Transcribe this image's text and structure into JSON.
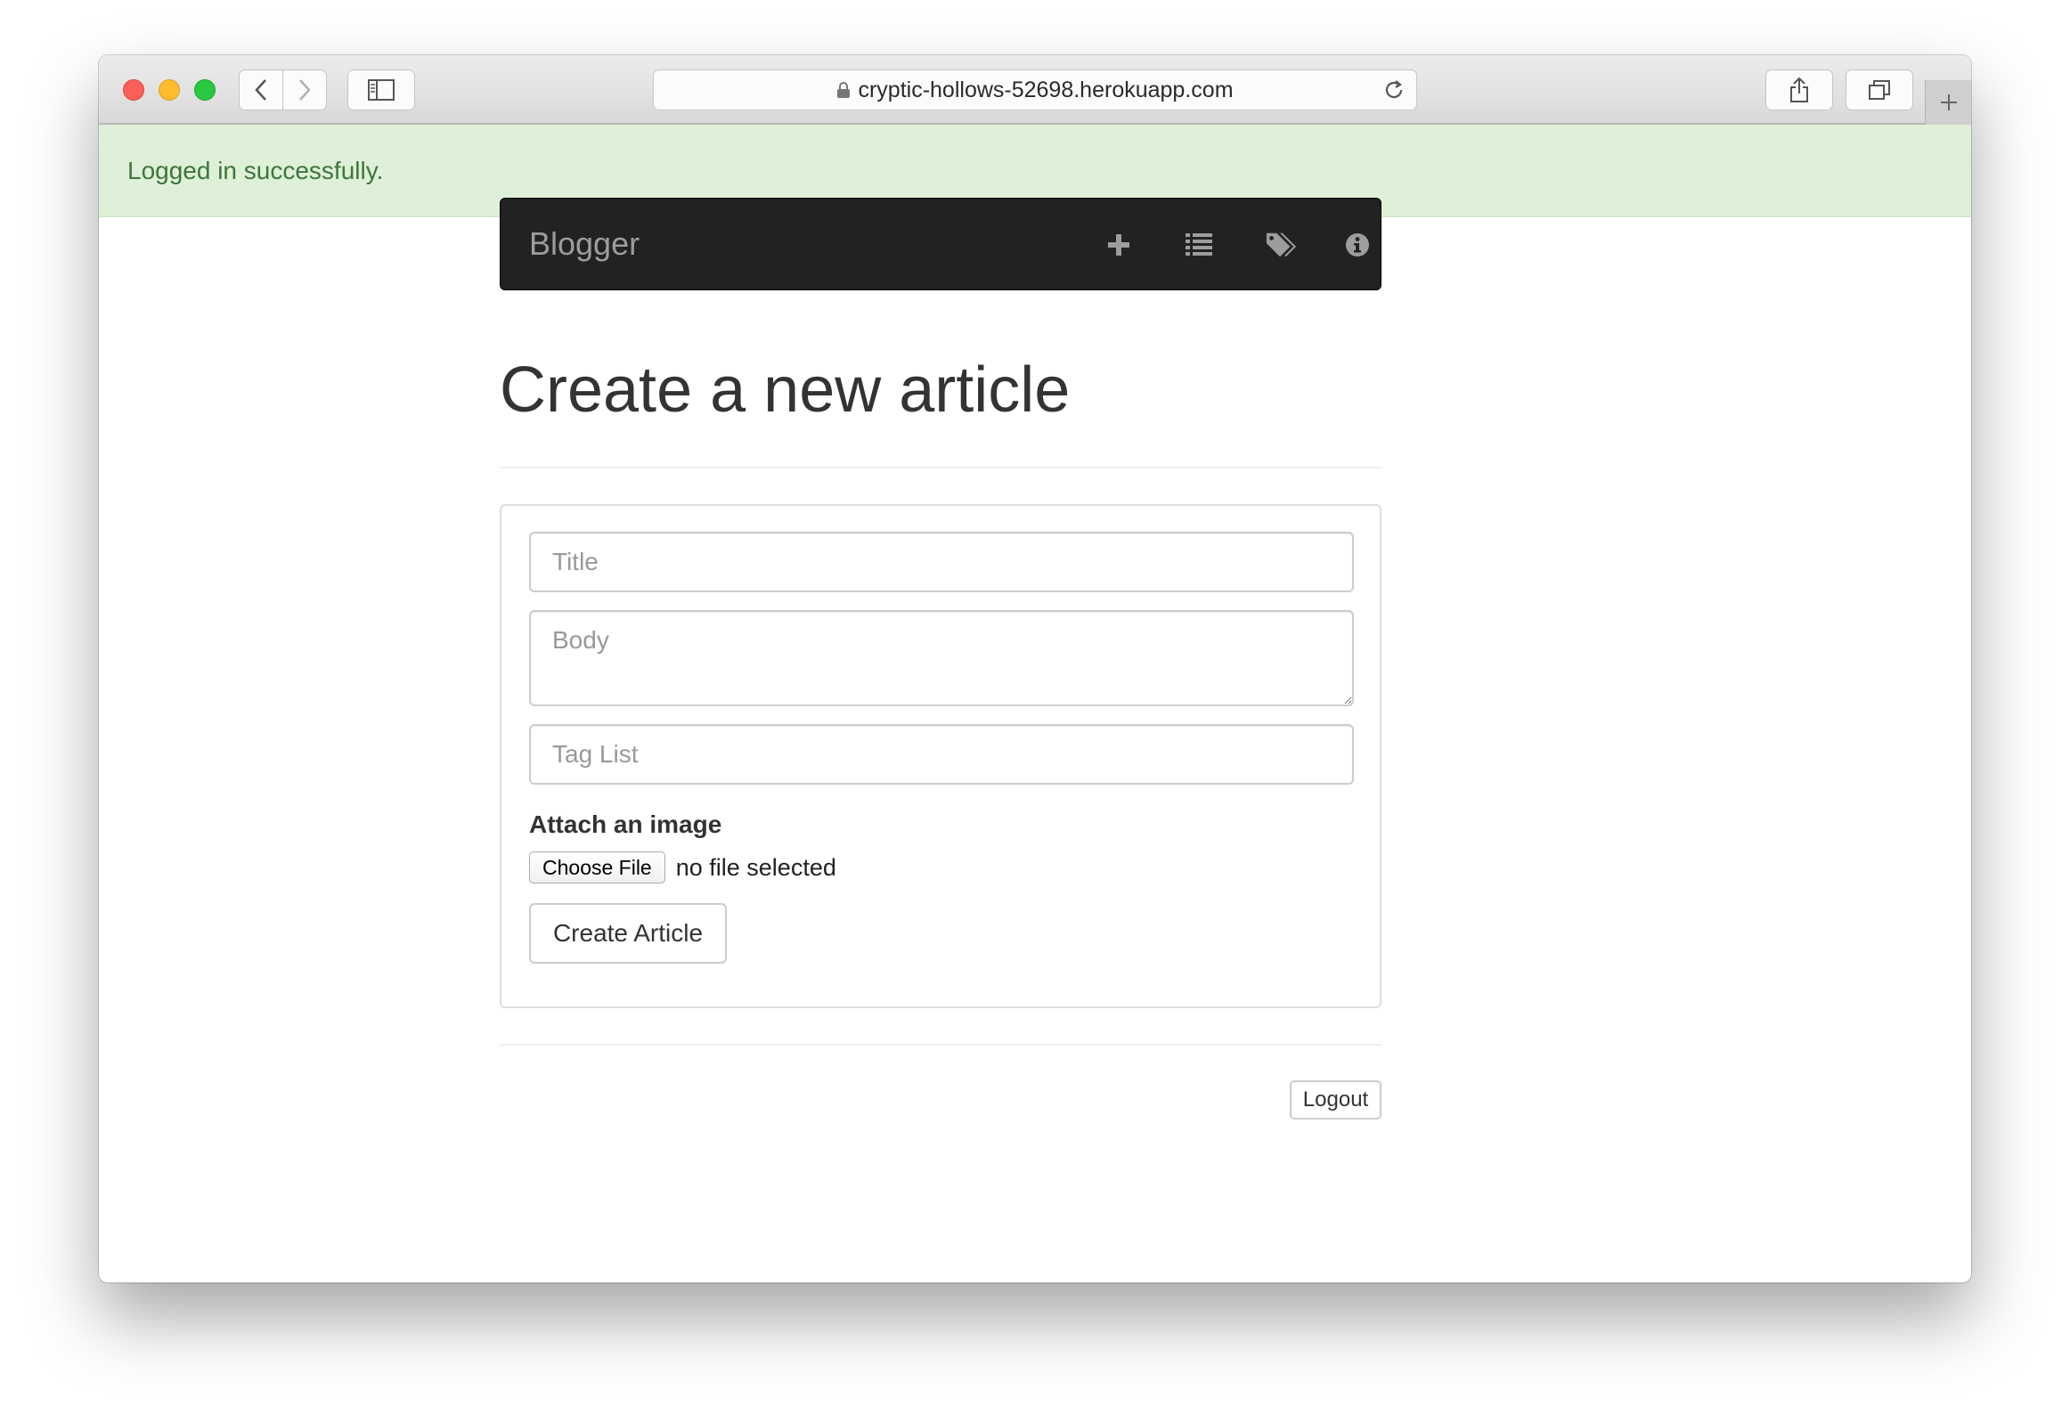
{
  "browser": {
    "url": "cryptic-hollows-52698.herokuapp.com"
  },
  "flash": {
    "message": "Logged in successfully.",
    "color": "#3c763d",
    "background": "#dff0d8"
  },
  "navbar": {
    "brand": "Blogger",
    "icons": [
      "plus-icon",
      "list-icon",
      "tags-icon",
      "info-icon"
    ]
  },
  "page": {
    "title": "Create a new article"
  },
  "form": {
    "title_placeholder": "Title",
    "body_placeholder": "Body",
    "tags_placeholder": "Tag List",
    "attach_label": "Attach an image",
    "choose_file_label": "Choose File",
    "file_status": "no file selected",
    "submit_label": "Create Article"
  },
  "footer": {
    "logout_label": "Logout"
  }
}
